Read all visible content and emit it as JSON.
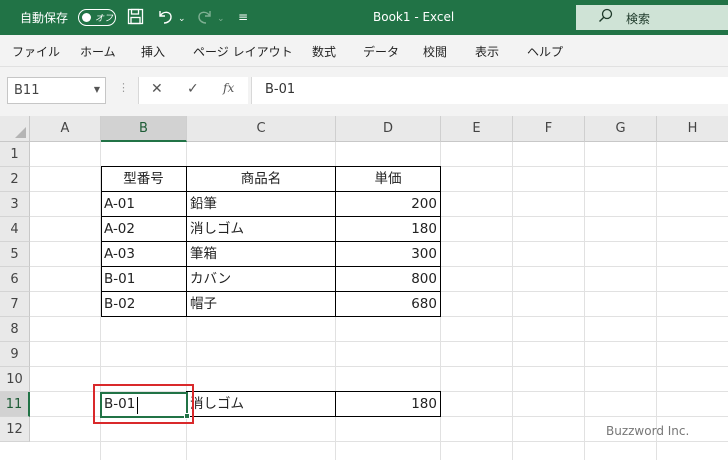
{
  "titlebar": {
    "autosave_label": "自動保存",
    "autosave_state": "オフ",
    "doc_title": "Book1  -  Excel",
    "search_placeholder": "検索",
    "icons": [
      "save-icon",
      "undo-icon",
      "redo-icon",
      "customize-quick-access-icon"
    ]
  },
  "menu": [
    "ファイル",
    "ホーム",
    "挿入",
    "ページ レイアウト",
    "数式",
    "データ",
    "校閲",
    "表示",
    "ヘルプ"
  ],
  "formula_bar": {
    "name_box": "B11",
    "cancel_glyph": "✕",
    "enter_glyph": "✓",
    "fx_glyph": "fx",
    "formula": "B-01"
  },
  "columns": [
    "A",
    "B",
    "C",
    "D",
    "E",
    "F",
    "G",
    "H"
  ],
  "rows": [
    "1",
    "2",
    "3",
    "4",
    "5",
    "6",
    "7",
    "8",
    "9",
    "10",
    "11",
    "12"
  ],
  "table": {
    "headers": [
      "型番号",
      "商品名",
      "単価"
    ],
    "rows": [
      [
        "A-01",
        "鉛筆",
        "200"
      ],
      [
        "A-02",
        "消しゴム",
        "180"
      ],
      [
        "A-03",
        "筆箱",
        "300"
      ],
      [
        "B-01",
        "カバン",
        "800"
      ],
      [
        "B-02",
        "帽子",
        "680"
      ]
    ]
  },
  "lookup_row": {
    "key": "B-01",
    "name": "消しゴム",
    "price": "180"
  },
  "selected": {
    "column": "B",
    "row": "11"
  },
  "watermark": "Buzzword Inc.",
  "colors": {
    "excel_green": "#217346",
    "highlight": "#d9292b"
  }
}
